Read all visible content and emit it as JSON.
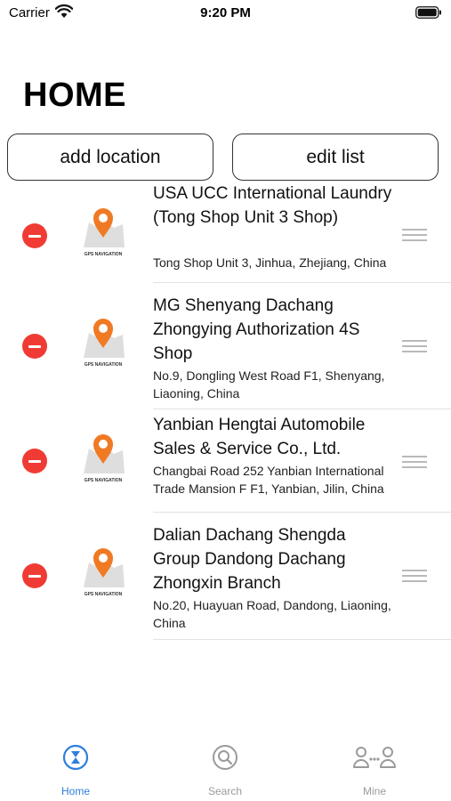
{
  "status_bar": {
    "carrier": "Carrier",
    "time": "9:20 PM"
  },
  "header": {
    "title": "HOME"
  },
  "actions": {
    "add_label": "add location",
    "edit_label": "edit list"
  },
  "thumbnail_caption": "GPS NAVIGATION",
  "locations": [
    {
      "title": "USA UCC International Laundry (Tong Shop Unit 3 Shop)",
      "address": "Tong Shop Unit 3, Jinhua, Zhejiang, China"
    },
    {
      "title": "MG Shenyang Dachang Zhongying Authorization 4S Shop",
      "address": "No.9, Dongling West Road F1, Shenyang, Liaoning, China"
    },
    {
      "title": "Yanbian Hengtai Automobile Sales & Service Co., Ltd.",
      "address": "Changbai Road 252 Yanbian International Trade Mansion F F1, Yanbian, Jilin, China"
    },
    {
      "title": "Dalian Dachang Shengda Group Dandong Dachang Zhongxin Branch",
      "address": "No.20, Huayuan Road, Dandong, Liaoning, China"
    }
  ],
  "tabs": [
    {
      "label": "Home",
      "icon": "hourglass-icon",
      "active": true
    },
    {
      "label": "Search",
      "icon": "search-icon",
      "active": false
    },
    {
      "label": "Mine",
      "icon": "people-icon",
      "active": false
    }
  ],
  "colors": {
    "accent": "#2f7fdd",
    "delete": "#f03b35",
    "pin": "#f07a23",
    "inactive": "#9a9a9a"
  }
}
